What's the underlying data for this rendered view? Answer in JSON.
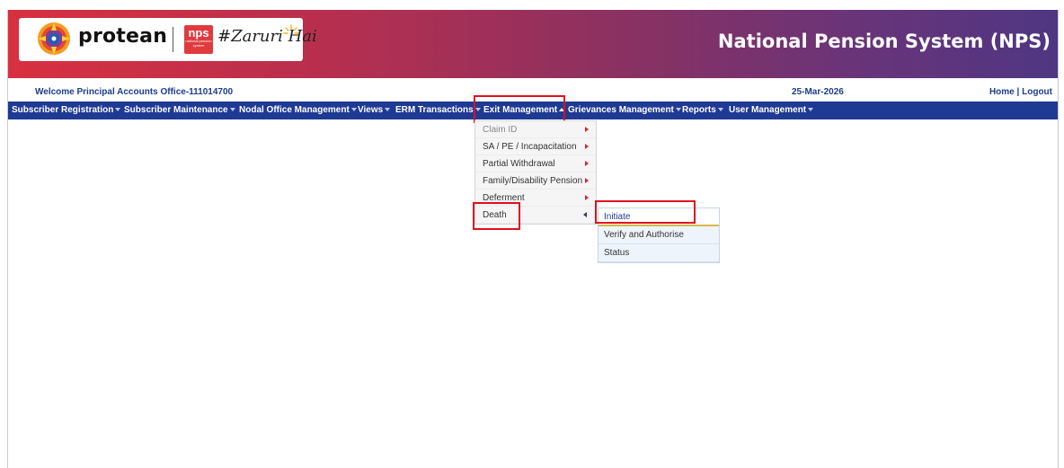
{
  "header": {
    "brand_name": "protean",
    "nps_badge_big": "nps",
    "nps_badge_small": "national pension system",
    "tagline": "#Zaruri Hai",
    "system_title": "National Pension System (NPS)"
  },
  "info_bar": {
    "welcome": "Welcome Principal Accounts Office-111014700",
    "date": "25-Mar-2026",
    "home": "Home",
    "separator": "|",
    "logout": "Logout"
  },
  "menu": {
    "items": [
      {
        "label": "Subscriber Registration"
      },
      {
        "label": "Subscriber Maintenance"
      },
      {
        "label": "Nodal Office Management"
      },
      {
        "label": "Views"
      },
      {
        "label": "ERM Transactions"
      },
      {
        "label": "Exit Management"
      },
      {
        "label": "Grievances Management"
      },
      {
        "label": "Reports"
      },
      {
        "label": "User Management"
      }
    ],
    "active": "Exit Management"
  },
  "exit_dropdown": {
    "items": [
      {
        "label": "Claim ID"
      },
      {
        "label": "SA / PE / Incapacitation"
      },
      {
        "label": "Partial Withdrawal"
      },
      {
        "label": "Family/Disability Pension"
      },
      {
        "label": "Deferment"
      },
      {
        "label": "Death"
      }
    ]
  },
  "death_submenu": {
    "items": [
      {
        "label": "Initiate"
      },
      {
        "label": "Verify and Authorise"
      },
      {
        "label": "Status"
      }
    ]
  },
  "colors": {
    "menu_bar": "#1f3a93",
    "highlight": "#e0101e",
    "header_start": "#d8303f",
    "header_end": "#4f3683"
  },
  "icons": {
    "brand": "protean-circle-icon",
    "tagline_decoration": "sun-rays-icon",
    "dropdown_caret": "caret-down-icon",
    "submenu_arrow": "caret-right-icon"
  }
}
